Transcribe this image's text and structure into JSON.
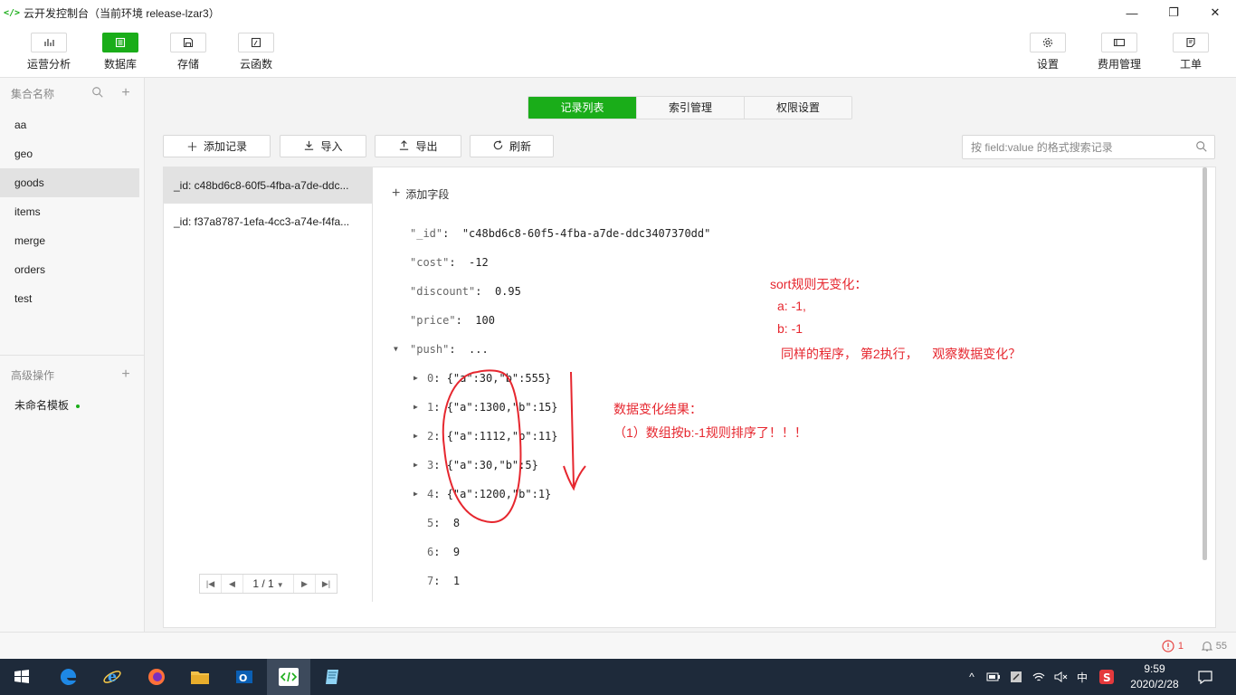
{
  "window": {
    "title": "云开发控制台（当前环境 release-lzar3）",
    "logo_text": "</>",
    "minimize": "—",
    "restore": "❐",
    "close": "✕"
  },
  "toolbar": {
    "left": [
      {
        "label": "运营分析",
        "icon": "bar-chart-icon"
      },
      {
        "label": "数据库",
        "icon": "database-icon",
        "active": true
      },
      {
        "label": "存储",
        "icon": "save-icon"
      },
      {
        "label": "云函数",
        "icon": "function-icon"
      }
    ],
    "right": [
      {
        "label": "设置",
        "icon": "gear-icon"
      },
      {
        "label": "费用管理",
        "icon": "card-icon"
      },
      {
        "label": "工单",
        "icon": "ticket-icon"
      }
    ]
  },
  "sidebar": {
    "collections_header": "集合名称",
    "collections": [
      "aa",
      "geo",
      "goods",
      "items",
      "merge",
      "orders",
      "test"
    ],
    "active_collection": "goods",
    "advanced_header": "高级操作",
    "template": "未命名模板"
  },
  "tabs": [
    {
      "label": "记录列表",
      "active": true
    },
    {
      "label": "索引管理"
    },
    {
      "label": "权限设置"
    }
  ],
  "actions": {
    "add": "添加记录",
    "import": "导入",
    "export": "导出",
    "refresh": "刷新"
  },
  "search": {
    "placeholder": "按 field:value 的格式搜索记录"
  },
  "records": [
    "_id: c48bd6c8-60f5-4fba-a7de-ddc...",
    "_id: f37a8787-1efa-4cc3-a74e-f4fa..."
  ],
  "pager": {
    "first": "|◀",
    "prev": "◀",
    "page": "1 / 1",
    "caret": "▼",
    "next": "▶",
    "last": "▶|"
  },
  "document": {
    "add_field": "添加字段",
    "fields": [
      {
        "key": "\"_id\"",
        "value": "\"c48bd6c8-60f5-4fba-a7de-ddc3407370dd\""
      },
      {
        "key": "\"cost\"",
        "value": "-12"
      },
      {
        "key": "\"discount\"",
        "value": "0.95"
      },
      {
        "key": "\"price\"",
        "value": "100"
      },
      {
        "key": "\"push\"",
        "value": "..."
      }
    ],
    "push_items": [
      {
        "index": "0",
        "value": "{\"a\":30,\"b\":555}",
        "expandable": true
      },
      {
        "index": "1",
        "value": "{\"a\":1300,\"b\":15}",
        "expandable": true
      },
      {
        "index": "2",
        "value": "{\"a\":1112,\"b\":11}",
        "expandable": true
      },
      {
        "index": "3",
        "value": "{\"a\":30,\"b\":5}",
        "expandable": true
      },
      {
        "index": "4",
        "value": "{\"a\":1200,\"b\":1}",
        "expandable": true
      },
      {
        "index": "5",
        "value": "8"
      },
      {
        "index": "6",
        "value": "9"
      },
      {
        "index": "7",
        "value": "1"
      }
    ]
  },
  "annotations": {
    "note1": [
      "sort规则无变化：",
      "a: -1,",
      "b: -1",
      "同样的程序， 第2执行，    观察数据变化？"
    ],
    "note2": [
      "数据变化结果：",
      "（1）数组按b:-1规则排序了！！！"
    ],
    "ink_color": "#e6272f"
  },
  "statusbar": {
    "warnings": "1",
    "notifications": "55"
  },
  "taskbar": {
    "apps": [
      "windows-start-icon",
      "edge-icon",
      "ie-icon",
      "firefox-icon",
      "file-explorer-icon",
      "outlook-icon",
      "devtools-icon",
      "notepad-icon"
    ],
    "tray": {
      "chevron": "^",
      "ime": "中"
    },
    "time": "9:59",
    "date": "2020/2/28"
  },
  "colors": {
    "accent": "#1aad19",
    "danger": "#e64340"
  }
}
